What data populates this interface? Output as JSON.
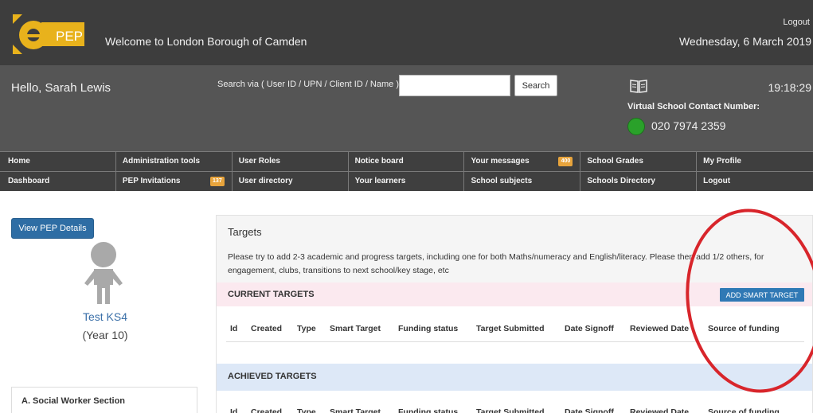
{
  "header": {
    "logo_text": "ePEP",
    "welcome": "Welcome to London Borough of Camden",
    "logout": "Logout",
    "date": "Wednesday, 6 March 2019"
  },
  "subheader": {
    "greeting": "Hello, Sarah Lewis",
    "search_label": "Search via ( User ID / UPN / Client ID / Name )",
    "search_value": "",
    "search_button": "Search",
    "time": "19:18:29",
    "contact_label": "Virtual School Contact Number:",
    "contact_number": "020 7974 2359",
    "status_color": "#2aa12a",
    "book_icon": "book-icon"
  },
  "nav": {
    "row1": [
      {
        "label": "Home"
      },
      {
        "label": "Administration tools"
      },
      {
        "label": "User Roles"
      },
      {
        "label": "Notice board"
      },
      {
        "label": "Your messages",
        "badge": "400"
      },
      {
        "label": "School Grades"
      },
      {
        "label": "My Profile"
      }
    ],
    "row2": [
      {
        "label": "Dashboard"
      },
      {
        "label": "PEP Invitations",
        "badge": "137"
      },
      {
        "label": "User directory"
      },
      {
        "label": "Your learners"
      },
      {
        "label": "School subjects"
      },
      {
        "label": "Schools Directory"
      },
      {
        "label": "Logout"
      }
    ],
    "badge_color": "#e8a43c"
  },
  "left": {
    "view_button": "View PEP Details",
    "learner_name": "Test KS4",
    "learner_year": "(Year 10)",
    "section_a": "A. Social Worker Section"
  },
  "targets": {
    "title": "Targets",
    "description": "Please try to add 2-3 academic and progress targets, including one for both Maths/numeracy and English/literacy. Please then add 1/2 others, for engagement, clubs, transitions to next school/key stage, etc",
    "current_title": "CURRENT TARGETS",
    "add_button": "ADD SMART TARGET",
    "achieved_title": "ACHIEVED TARGETS",
    "columns": [
      "Id",
      "Created",
      "Type",
      "Smart Target",
      "Funding status",
      "Target Submitted",
      "Date Signoff",
      "Reviewed Date",
      "Source of funding"
    ]
  },
  "colors": {
    "header_bg": "#3d3d3d",
    "subheader_bg": "#555555",
    "primary_button": "#2e6da4",
    "current_bar": "#fbe9ef",
    "achieved_bar": "#dde8f7",
    "annotation_ring": "#d8252b"
  }
}
